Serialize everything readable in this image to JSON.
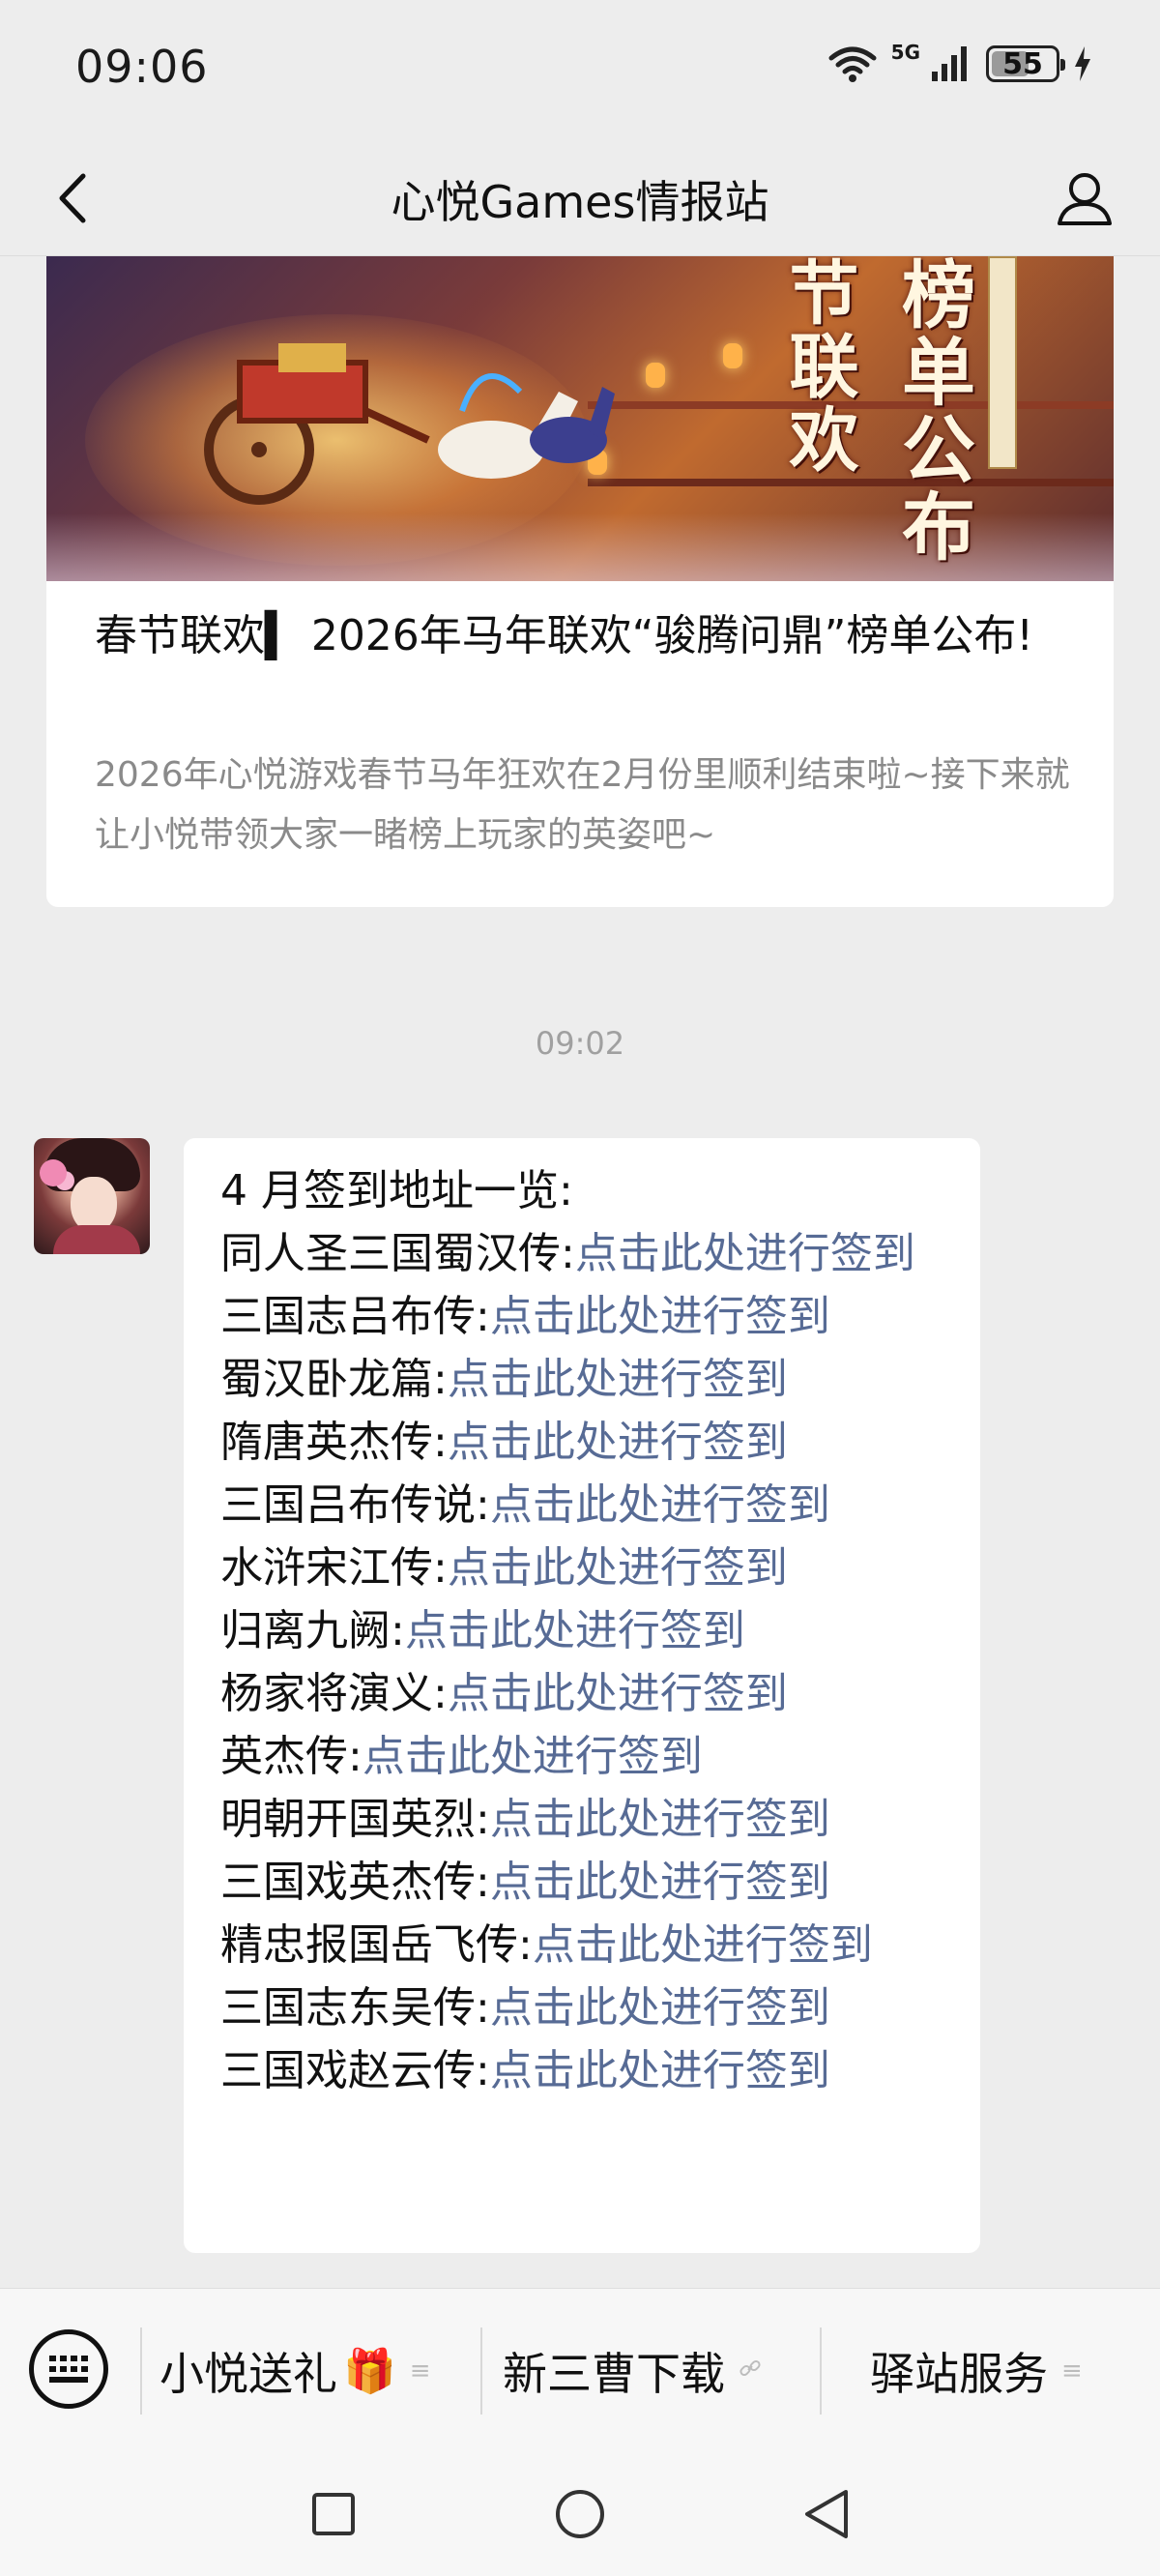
{
  "status_bar": {
    "time": "09:06",
    "network_label": "5G",
    "battery_level": "55"
  },
  "nav": {
    "title": "心悦Games情报站"
  },
  "article": {
    "banner_title_a": "榜单公布",
    "banner_title_b": "节联欢",
    "title": "春节联欢▍ 2026年马年联欢“骏腾问鼎”榜单公布!",
    "summary": "2026年心悦游戏春节马年狂欢在2月份里顺利结束啦~接下来就让小悦带领大家一睹榜上玩家的英姿吧~"
  },
  "timestamp": "09:02",
  "message": {
    "heading": "4 月签到地址一览:",
    "link_text": "点击此处进行签到",
    "items": [
      {
        "game": "同人圣三国蜀汉传:",
        "link": "点击此处进行签到"
      },
      {
        "game": "三国志吕布传:",
        "link": "点击此处进行签到"
      },
      {
        "game": "蜀汉卧龙篇:",
        "link": "点击此处进行签到"
      },
      {
        "game": "隋唐英杰传:",
        "link": "点击此处进行签到"
      },
      {
        "game": "三国吕布传说:",
        "link": "点击此处进行签到"
      },
      {
        "game": "水浒宋江传:",
        "link": "点击此处进行签到"
      },
      {
        "game": "归离九阙:",
        "link": "点击此处进行签到"
      },
      {
        "game": "杨家将演义:",
        "link": "点击此处进行签到"
      },
      {
        "game": "英杰传:",
        "link": "点击此处进行签到"
      },
      {
        "game": "明朝开国英烈:",
        "link": "点击此处进行签到"
      },
      {
        "game": "三国戏英杰传:",
        "link": "点击此处进行签到"
      },
      {
        "game": "精忠报国岳飞传:",
        "link": "点击此处进行签到"
      },
      {
        "game": "三国志东吴传:",
        "link": "点击此处进行签到"
      },
      {
        "game": "三国戏赵云传:",
        "link": "点击此处进行签到"
      }
    ]
  },
  "bottom_menu": {
    "items": [
      {
        "label": "小悦送礼",
        "icon": "gift-icon",
        "indicator": "≡"
      },
      {
        "label": "新三曹下载",
        "icon": "link-icon",
        "indicator": "🔗"
      },
      {
        "label": "驿站服务",
        "icon": "menu-icon",
        "indicator": "≡"
      }
    ]
  },
  "colors": {
    "link": "#576b95",
    "background": "#ededed",
    "bubble": "#ffffff",
    "muted_text": "#8a8a8a"
  }
}
